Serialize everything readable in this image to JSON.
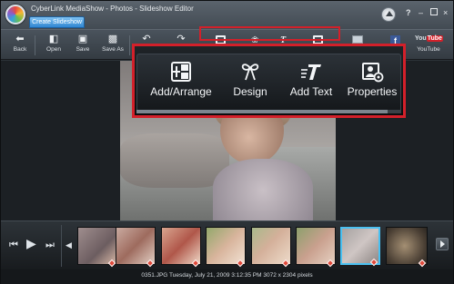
{
  "window": {
    "title": "CyberLink MediaShow - Photos - Slideshow Editor",
    "help_label": "?",
    "minimize_label": "–",
    "close_label": "×"
  },
  "mode_tab": {
    "label": "Create Slideshow"
  },
  "toolbar": {
    "back_label": "Back",
    "open_label": "Open",
    "save_label": "Save",
    "save_as_label": "Save As",
    "youtube_label": "YouTube",
    "youtube_logo_you": "You",
    "youtube_logo_tube": "Tube",
    "facebook_glyph": "f"
  },
  "panel": {
    "items": [
      {
        "label": "Add/Arrange",
        "icon": "add-arrange-icon"
      },
      {
        "label": "Design",
        "icon": "design-icon"
      },
      {
        "label": "Add Text",
        "icon": "add-text-icon"
      },
      {
        "label": "Properties",
        "icon": "properties-icon"
      }
    ]
  },
  "status": {
    "text": "0351.JPG  Tuesday, July 21, 2009 3:12:35 PM  3072 x 2304 pixels"
  },
  "colors": {
    "highlight": "#d3202a",
    "selection": "#4ac1f2",
    "tab_accent": "#2f86d2"
  }
}
